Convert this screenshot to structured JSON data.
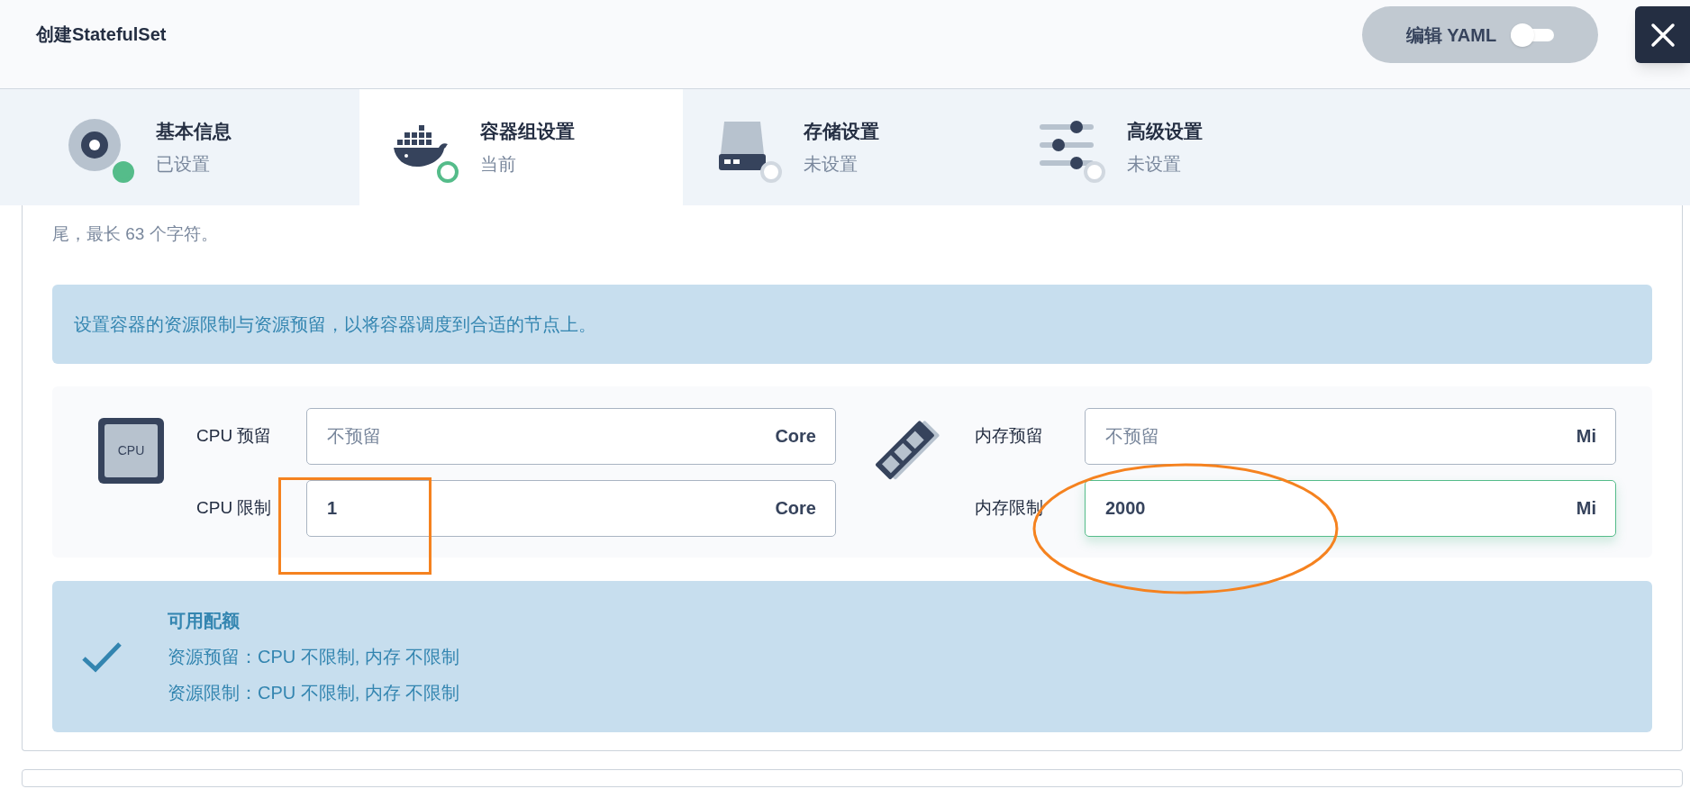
{
  "header": {
    "title": "创建StatefulSet",
    "yaml_toggle": {
      "label": "编辑 YAML",
      "on": false
    }
  },
  "steps": [
    {
      "title": "基本信息",
      "status_text": "已设置",
      "kind": "done",
      "selected": false
    },
    {
      "title": "容器组设置",
      "status_text": "当前",
      "kind": "current",
      "selected": true
    },
    {
      "title": "存储设置",
      "status_text": "未设置",
      "kind": "todo",
      "selected": false
    },
    {
      "title": "高级设置",
      "status_text": "未设置",
      "kind": "todo",
      "selected": false
    }
  ],
  "hint": "尾，最长 63 个字符。",
  "info_banner": "设置容器的资源限制与资源预留，以将容器调度到合适的节点上。",
  "resources": [
    {
      "icon_text": "CPU",
      "fields": [
        {
          "label": "CPU 预留",
          "placeholder": "不预留",
          "unit": "Core",
          "focused": false
        },
        {
          "label": "CPU 限制",
          "value": "1",
          "unit": "Core",
          "focused": false
        }
      ]
    },
    {
      "fields": [
        {
          "label": "内存预留",
          "placeholder": "不预留",
          "unit": "Mi",
          "focused": false
        },
        {
          "label": "内存限制",
          "value": "2000",
          "unit": "Mi",
          "focused": true
        }
      ]
    }
  ],
  "quota": {
    "title": "可用配额",
    "lines": [
      "资源预留：CPU 不限制, 内存 不限制",
      "资源限制：CPU 不限制, 内存 不限制"
    ]
  },
  "annotations": [
    {
      "kind": "rectangle"
    },
    {
      "kind": "ellipse"
    }
  ]
}
